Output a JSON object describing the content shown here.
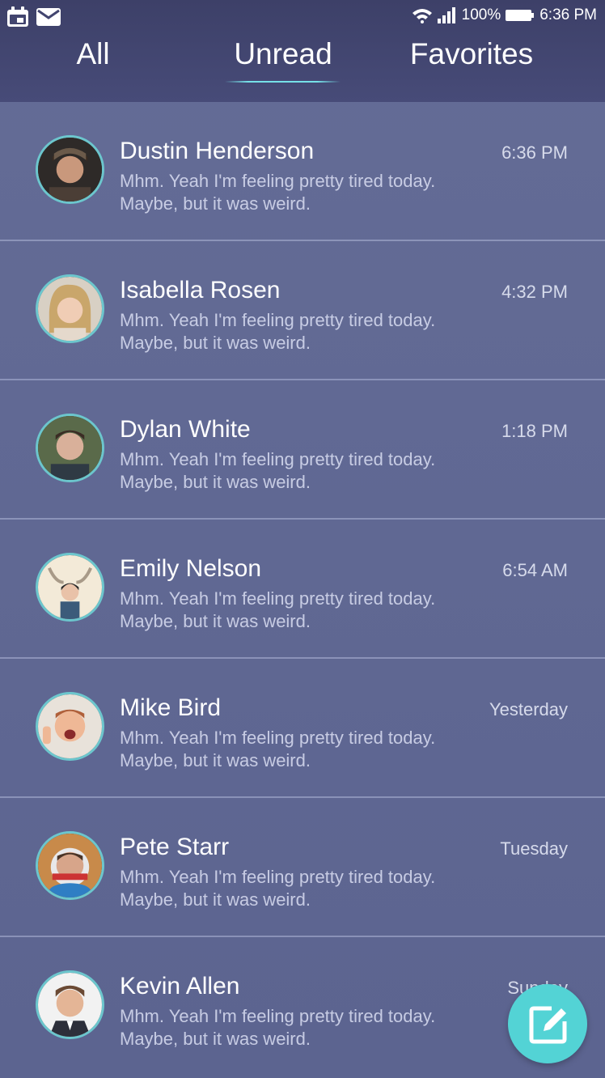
{
  "status_bar": {
    "battery": "100%",
    "time": "6:36 PM",
    "left_icons": [
      "calendar-icon",
      "mail-icon"
    ],
    "right_icons": [
      "wifi-icon",
      "signal-icon",
      "battery-icon"
    ]
  },
  "tabs": [
    {
      "label": "All",
      "active": false
    },
    {
      "label": "Unread",
      "active": true
    },
    {
      "label": "Favorites",
      "active": false
    }
  ],
  "colors": {
    "accent": "#53d3d5",
    "header": "#42456f",
    "list_bg": "#606893",
    "avatar_ring": "#6cc6cd"
  },
  "conversations": [
    {
      "name": "Dustin Henderson",
      "time": "6:36 PM",
      "line1": "Mhm. Yeah I'm feeling pretty tired today.",
      "line2": "Maybe, but it was weird."
    },
    {
      "name": "Isabella Rosen",
      "time": "4:32 PM",
      "line1": "Mhm. Yeah I'm feeling pretty tired today.",
      "line2": "Maybe, but it was weird."
    },
    {
      "name": "Dylan White",
      "time": "1:18 PM",
      "line1": "Mhm. Yeah I'm feeling pretty tired today.",
      "line2": "Maybe, but it was weird."
    },
    {
      "name": "Emily Nelson",
      "time": "6:54 AM",
      "line1": "Mhm. Yeah I'm feeling pretty tired today.",
      "line2": "Maybe, but it was weird."
    },
    {
      "name": "Mike Bird",
      "time": "Yesterday",
      "line1": "Mhm. Yeah I'm feeling pretty tired today.",
      "line2": "Maybe, but it was weird."
    },
    {
      "name": "Pete Starr",
      "time": "Tuesday",
      "line1": "Mhm. Yeah I'm feeling pretty tired today.",
      "line2": "Maybe, but it was weird."
    },
    {
      "name": "Kevin Allen",
      "time": "Sunday",
      "line1": "Mhm. Yeah I'm feeling pretty tired today.",
      "line2": "Maybe, but it was weird."
    }
  ],
  "fab": {
    "icon": "compose-icon"
  }
}
